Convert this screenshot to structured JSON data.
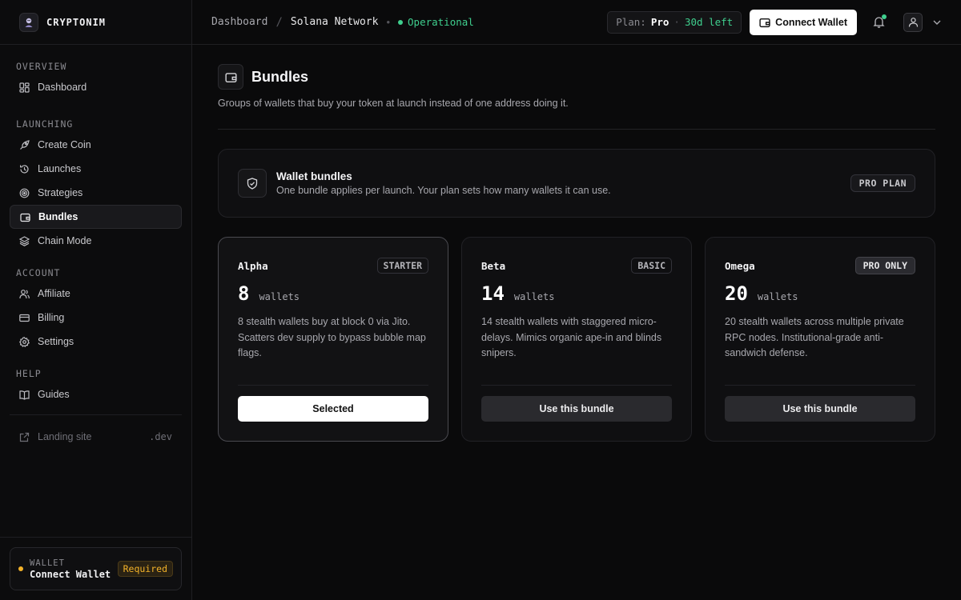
{
  "brand": {
    "name": "CRYPTONIM"
  },
  "sidebar": {
    "sections": [
      {
        "title": "OVERVIEW",
        "items": [
          {
            "label": "Dashboard",
            "icon": "dashboard-icon"
          }
        ]
      },
      {
        "title": "LAUNCHING",
        "items": [
          {
            "label": "Create Coin",
            "icon": "rocket-icon"
          },
          {
            "label": "Launches",
            "icon": "history-icon"
          },
          {
            "label": "Strategies",
            "icon": "target-icon"
          },
          {
            "label": "Bundles",
            "icon": "wallet-icon",
            "active": true
          },
          {
            "label": "Chain Mode",
            "icon": "layers-icon"
          }
        ]
      },
      {
        "title": "ACCOUNT",
        "items": [
          {
            "label": "Affiliate",
            "icon": "users-icon"
          },
          {
            "label": "Billing",
            "icon": "card-icon"
          },
          {
            "label": "Settings",
            "icon": "gear-icon"
          }
        ]
      },
      {
        "title": "HELP",
        "items": [
          {
            "label": "Guides",
            "icon": "book-icon"
          }
        ]
      }
    ],
    "landing": {
      "label": "Landing site",
      "suffix": ".dev"
    },
    "wallet": {
      "caption": "WALLET",
      "value": "Connect Wallet",
      "badge": "Required"
    }
  },
  "topbar": {
    "crumbs": [
      "Dashboard",
      "Solana Network"
    ],
    "status": "Operational",
    "plan": {
      "label": "Plan:",
      "value": "Pro",
      "remaining": "30d left"
    },
    "connect_label": "Connect Wallet"
  },
  "page": {
    "title": "Bundles",
    "subtitle": "Groups of wallets that buy your token at launch instead of one address doing it."
  },
  "info": {
    "title": "Wallet bundles",
    "desc": "One bundle applies per launch. Your plan sets how many wallets it can use.",
    "badge": "PRO PLAN"
  },
  "bundles": [
    {
      "name": "Alpha",
      "tier": "STARTER",
      "count": "8",
      "unit": "wallets",
      "desc": "8 stealth wallets buy at block 0 via Jito. Scatters dev supply to bypass bubble map flags.",
      "button": "Selected",
      "selected": true
    },
    {
      "name": "Beta",
      "tier": "BASIC",
      "count": "14",
      "unit": "wallets",
      "desc": "14 stealth wallets with staggered micro-delays. Mimics organic ape-in and blinds snipers.",
      "button": "Use this bundle",
      "selected": false
    },
    {
      "name": "Omega",
      "tier": "PRO ONLY",
      "count": "20",
      "unit": "wallets",
      "desc": "20 stealth wallets across multiple private RPC nodes. Institutional-grade anti-sandwich defense.",
      "button": "Use this bundle",
      "selected": false
    }
  ],
  "colors": {
    "accent_green": "#3fcf8e",
    "warning": "#f3b229",
    "background": "#0a0a0b"
  }
}
